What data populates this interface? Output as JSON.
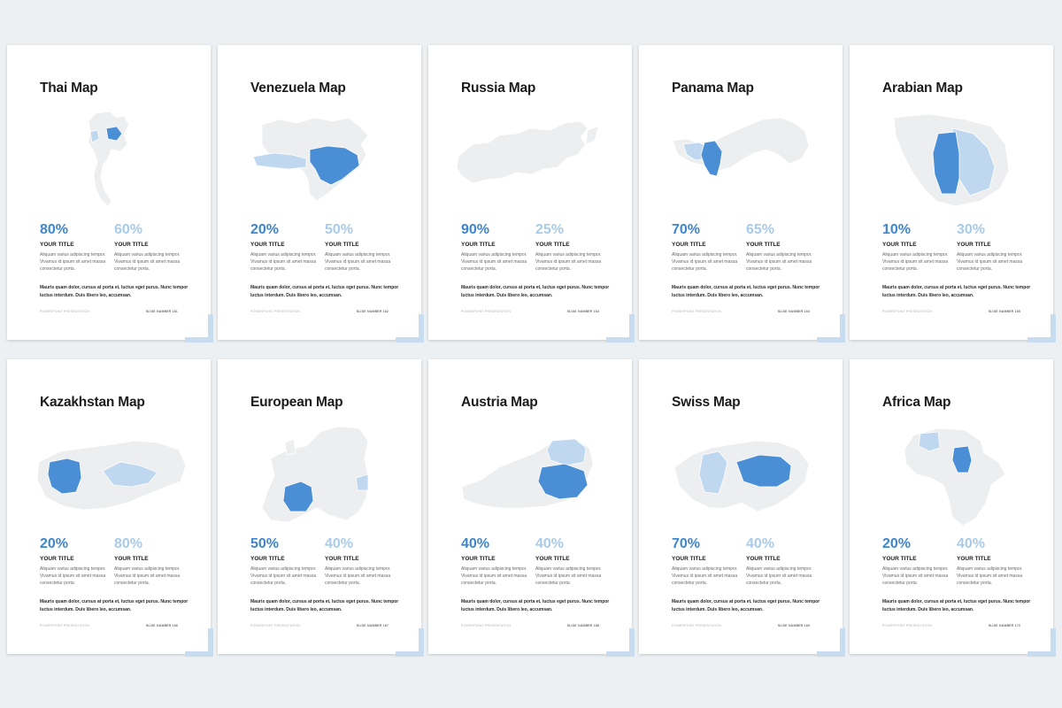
{
  "colors": {
    "primary": "#4a8fd6",
    "secondary": "#bfd8f0",
    "land": "#eceeef",
    "background": "#edf0f2"
  },
  "common": {
    "your_title": "YOUR TITLE",
    "desc": "Aliquam varius adipiscing tempor. Vivamus id ipsum sit amet massa consectetur porta.",
    "body": "Mauris quam dolor, cursus at porta et, luctus eget purus. Nunc tempor luctus interdum. Duis libero leo, accumsan.",
    "footer_left": "POWERPOINT PRESENTATION"
  },
  "slides": [
    {
      "title": "Thai Map",
      "pct_a": "80%",
      "pct_b": "60%",
      "slide_number": "SLIDE NUMBER 161",
      "map": "thailand"
    },
    {
      "title": "Venezuela Map",
      "pct_a": "20%",
      "pct_b": "50%",
      "slide_number": "SLIDE NUMBER 162",
      "map": "venezuela"
    },
    {
      "title": "Russia Map",
      "pct_a": "90%",
      "pct_b": "25%",
      "slide_number": "SLIDE NUMBER 163",
      "map": "russia"
    },
    {
      "title": "Panama Map",
      "pct_a": "70%",
      "pct_b": "65%",
      "slide_number": "SLIDE NUMBER 164",
      "map": "panama"
    },
    {
      "title": "Arabian Map",
      "pct_a": "10%",
      "pct_b": "30%",
      "slide_number": "SLIDE NUMBER 165",
      "map": "arabia"
    },
    {
      "title": "Kazakhstan Map",
      "pct_a": "20%",
      "pct_b": "80%",
      "slide_number": "SLIDE NUMBER 166",
      "map": "kazakhstan"
    },
    {
      "title": "European Map",
      "pct_a": "50%",
      "pct_b": "40%",
      "slide_number": "SLIDE NUMBER 167",
      "map": "europe"
    },
    {
      "title": "Austria Map",
      "pct_a": "40%",
      "pct_b": "40%",
      "slide_number": "SLIDE NUMBER 168",
      "map": "austria"
    },
    {
      "title": "Swiss Map",
      "pct_a": "70%",
      "pct_b": "40%",
      "slide_number": "SLIDE NUMBER 169",
      "map": "switzerland"
    },
    {
      "title": "Africa Map",
      "pct_a": "20%",
      "pct_b": "40%",
      "slide_number": "SLIDE NUMBER 170",
      "map": "africa"
    }
  ]
}
